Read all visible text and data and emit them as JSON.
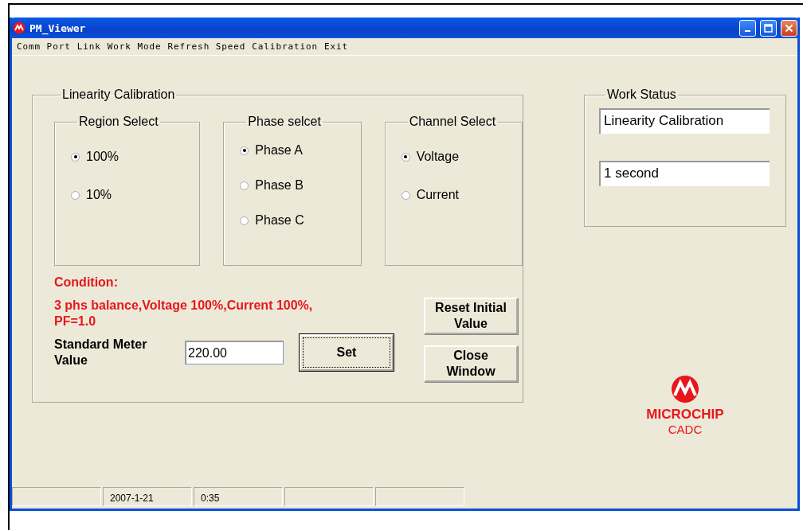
{
  "window": {
    "title": "PM_Viewer"
  },
  "menu": [
    "Comm Port",
    "Link",
    "Work Mode",
    "Refresh Speed",
    "Calibration",
    "Exit"
  ],
  "calibration": {
    "title": "Linearity Calibration",
    "groups": [
      {
        "title": "Region Select",
        "options": [
          {
            "label": "100%",
            "selected": true
          },
          {
            "label": "10%",
            "selected": false
          }
        ]
      },
      {
        "title": "Phase selcet",
        "options": [
          {
            "label": "Phase A",
            "selected": true
          },
          {
            "label": "Phase B",
            "selected": false
          },
          {
            "label": "Phase C",
            "selected": false
          }
        ]
      },
      {
        "title": "Channel Select",
        "options": [
          {
            "label": "Voltage",
            "selected": true
          },
          {
            "label": "Current",
            "selected": false
          }
        ]
      }
    ],
    "condition_label": "Condition:",
    "condition_text": "3 phs balance,Voltage 100%,Current 100%, PF=1.0",
    "meter_label": "Standard Meter Value",
    "meter_value": "220.00",
    "set_button": {
      "label": "Set",
      "focused": true
    },
    "reset_button": {
      "label": "Reset Initial Value",
      "focused": false
    },
    "close_button": {
      "label": "Close Window",
      "focused": false
    }
  },
  "work_status": {
    "title": "Work Status",
    "fields": [
      "Linearity Calibration",
      "1 second"
    ]
  },
  "logo": {
    "brand": "MICROCHIP",
    "subtitle": "CADC"
  },
  "status_bar": {
    "date": "2007-1-21",
    "time": "0:35"
  }
}
